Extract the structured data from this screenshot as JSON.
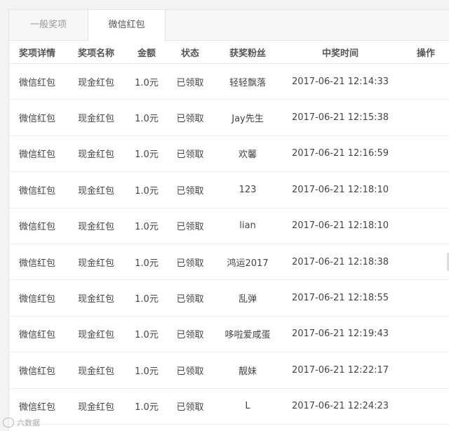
{
  "tabs": [
    {
      "label": "一般奖项",
      "active": false
    },
    {
      "label": "微信红包",
      "active": true
    }
  ],
  "columns": [
    "奖项详情",
    "奖项名称",
    "金额",
    "状态",
    "获奖粉丝",
    "中奖时间",
    "操作"
  ],
  "rows": [
    {
      "detail": "微信红包",
      "name": "现金红包",
      "amount": "1.0元",
      "status": "已领取",
      "fan": "轻轻飘落",
      "time": "2017-06-21 12:14:33",
      "action": ""
    },
    {
      "detail": "微信红包",
      "name": "现金红包",
      "amount": "1.0元",
      "status": "已领取",
      "fan": "Jay先生",
      "time": "2017-06-21 12:15:38",
      "action": ""
    },
    {
      "detail": "微信红包",
      "name": "现金红包",
      "amount": "1.0元",
      "status": "已领取",
      "fan": "欢馨",
      "time": "2017-06-21 12:16:59",
      "action": ""
    },
    {
      "detail": "微信红包",
      "name": "现金红包",
      "amount": "1.0元",
      "status": "已领取",
      "fan": "123",
      "time": "2017-06-21 12:18:10",
      "action": ""
    },
    {
      "detail": "微信红包",
      "name": "现金红包",
      "amount": "1.0元",
      "status": "已领取",
      "fan": "lian",
      "time": "2017-06-21 12:18:10",
      "action": ""
    },
    {
      "detail": "微信红包",
      "name": "现金红包",
      "amount": "1.0元",
      "status": "已领取",
      "fan": "鸿运2017",
      "time": "2017-06-21 12:18:38",
      "action": ""
    },
    {
      "detail": "微信红包",
      "name": "现金红包",
      "amount": "1.0元",
      "status": "已领取",
      "fan": "乱弹",
      "time": "2017-06-21 12:18:55",
      "action": ""
    },
    {
      "detail": "微信红包",
      "name": "现金红包",
      "amount": "1.0元",
      "status": "已领取",
      "fan": "哆啦爱咸蛋",
      "time": "2017-06-21 12:19:43",
      "action": ""
    },
    {
      "detail": "微信红包",
      "name": "现金红包",
      "amount": "1.0元",
      "status": "已领取",
      "fan": "靓妹",
      "time": "2017-06-21 12:22:17",
      "action": ""
    },
    {
      "detail": "微信红包",
      "name": "现金红包",
      "amount": "1.0元",
      "status": "已领取",
      "fan": "L",
      "time": "2017-06-21 12:24:23",
      "action": ""
    }
  ],
  "watermark": "六数据"
}
